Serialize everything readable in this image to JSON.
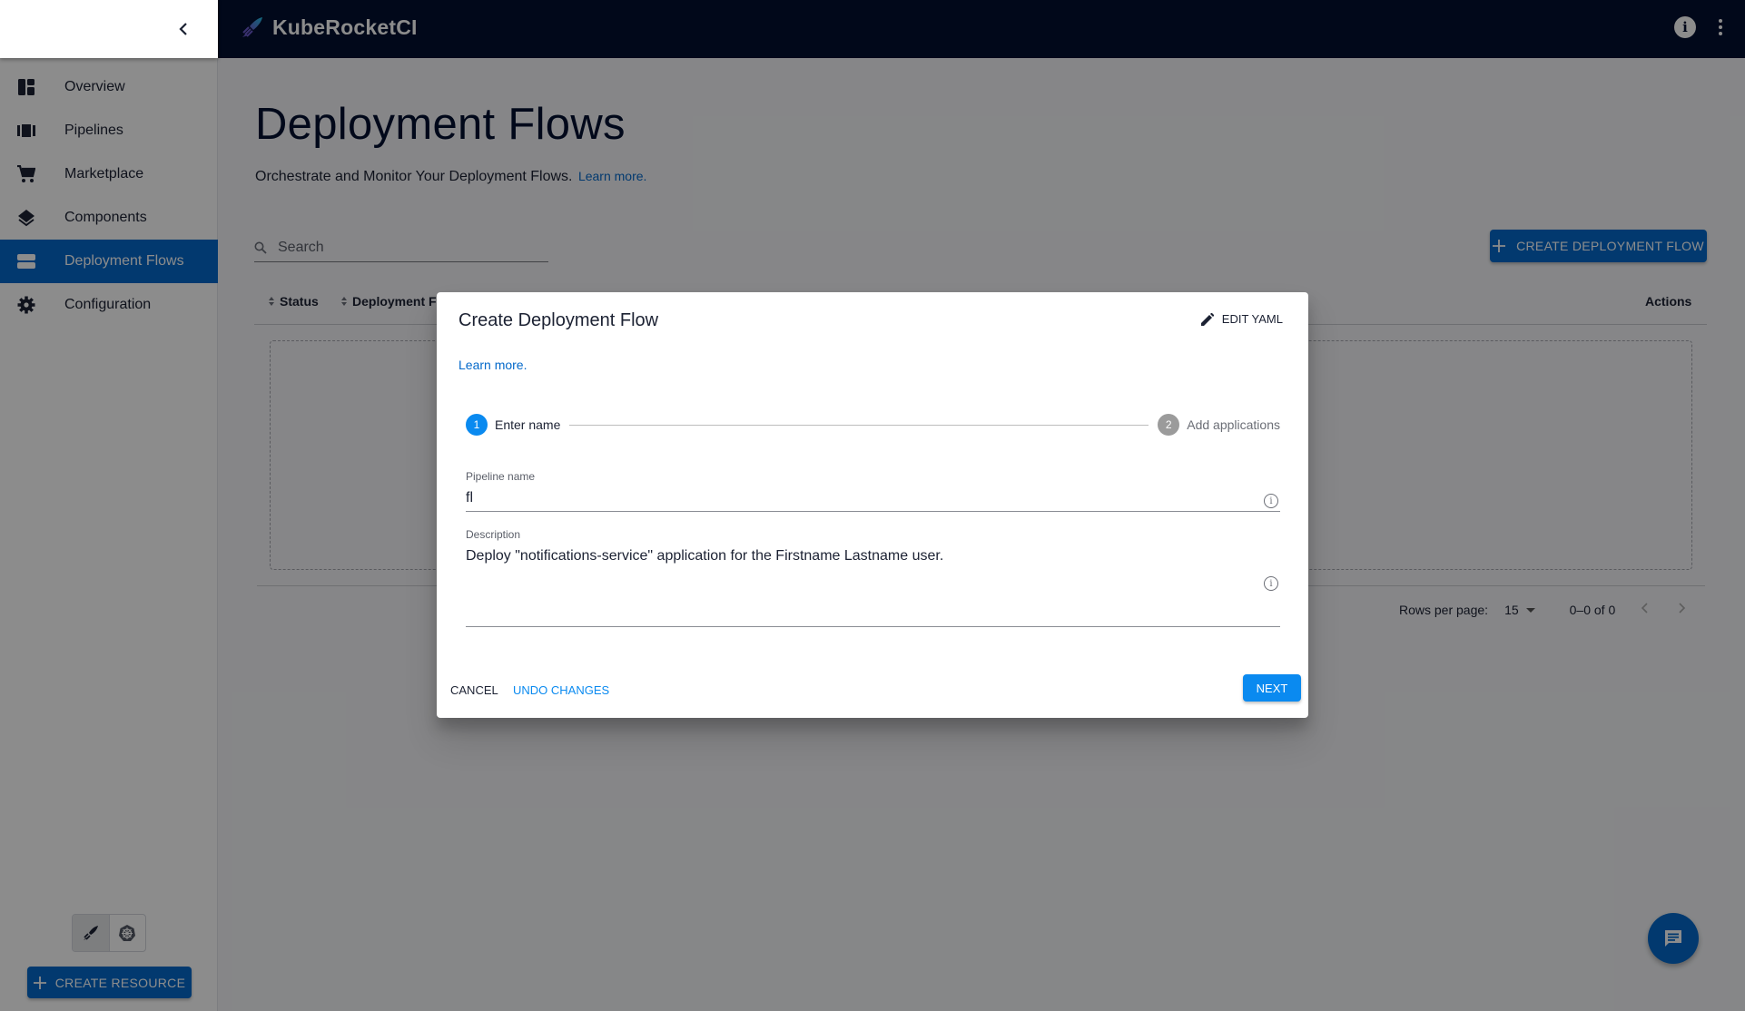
{
  "app": {
    "name": "KubeRocketCI",
    "icons": {
      "collapse": "chevron-left-icon",
      "logo": "rocket-logo-icon",
      "info": "info-icon",
      "menu": "more-vert-icon"
    }
  },
  "sidebar": {
    "items": [
      {
        "label": "Overview",
        "icon": "dashboard-icon",
        "active": false
      },
      {
        "label": "Pipelines",
        "icon": "view-carousel-icon",
        "active": false
      },
      {
        "label": "Marketplace",
        "icon": "cart-icon",
        "active": false
      },
      {
        "label": "Components",
        "icon": "layers-icon",
        "active": false
      },
      {
        "label": "Deployment Flows",
        "icon": "storage-icon",
        "active": true
      },
      {
        "label": "Configuration",
        "icon": "gear-icon",
        "active": false
      }
    ],
    "theme_toggle": [
      "rocket-icon",
      "kubernetes-icon"
    ],
    "create_resource_label": "CREATE RESOURCE"
  },
  "main": {
    "title": "Deployment Flows",
    "subtitle": "Orchestrate and Monitor Your Deployment Flows.",
    "learn_more": "Learn more.",
    "search_placeholder": "Search",
    "create_button": "CREATE DEPLOYMENT FLOW",
    "table": {
      "columns": [
        "Status",
        "Deployment Flow",
        "Actions"
      ],
      "visible_partial_column": "Deployment F",
      "rows": []
    },
    "pagination": {
      "rows_per_page_label": "Rows per page:",
      "rows_per_page": "15",
      "range": "0–0 of 0"
    }
  },
  "dialog": {
    "title": "Create Deployment Flow",
    "edit_yaml": "EDIT YAML",
    "learn_more": "Learn more.",
    "steps": [
      {
        "number": "1",
        "label": "Enter name",
        "active": true
      },
      {
        "number": "2",
        "label": "Add applications",
        "active": false
      }
    ],
    "fields": {
      "pipeline_name": {
        "label": "Pipeline name",
        "value": "fl"
      },
      "description": {
        "label": "Description",
        "value": "Deploy \"notifications-service\" application for the Firstname Lastname user."
      }
    },
    "actions": {
      "cancel": "CANCEL",
      "undo": "UNDO CHANGES",
      "next": "NEXT"
    }
  },
  "colors": {
    "appbar": "#021030",
    "primary": "#0469ca",
    "dialog_accent": "#0a8af0",
    "backdrop": "rgba(0,0,0,0.45)"
  }
}
